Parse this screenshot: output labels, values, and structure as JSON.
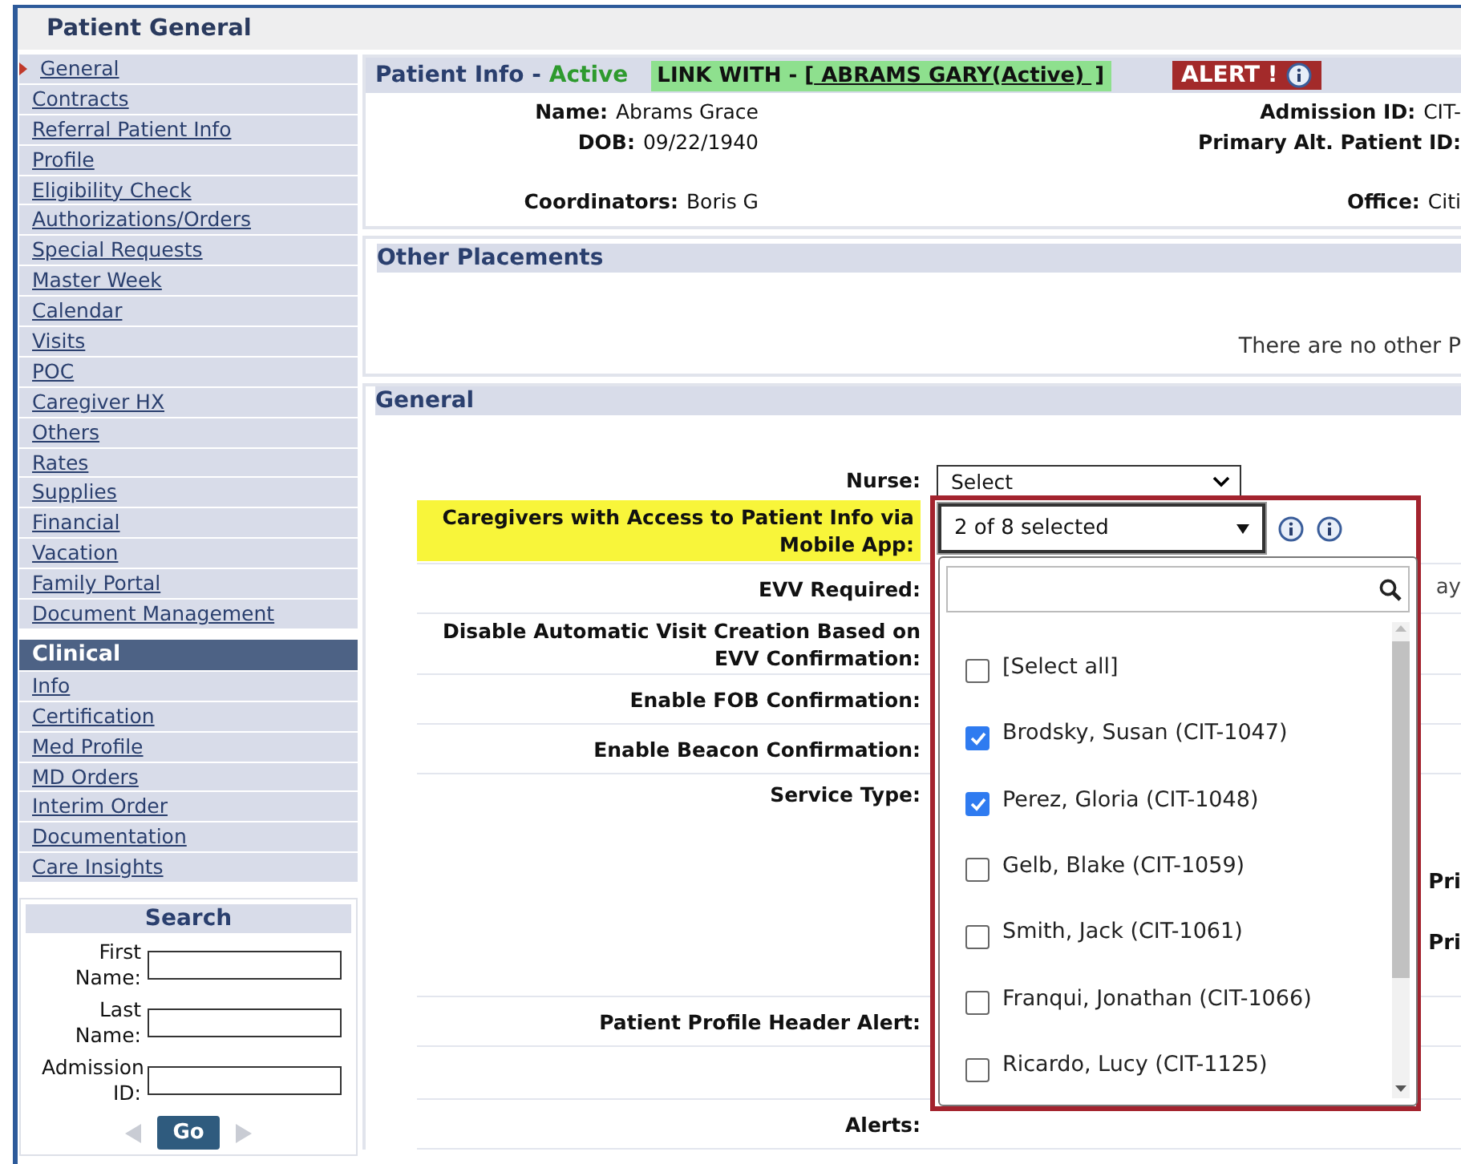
{
  "window": {
    "title": "Patient General"
  },
  "sidebar": {
    "items": [
      {
        "label": "General",
        "selected": true
      },
      {
        "label": "Contracts",
        "selected": false
      },
      {
        "label": "Referral Patient Info",
        "selected": false
      },
      {
        "label": "Profile",
        "selected": false
      },
      {
        "label": "Eligibility Check",
        "selected": false
      },
      {
        "label": "Authorizations/Orders",
        "selected": false
      },
      {
        "label": "Special Requests",
        "selected": false
      },
      {
        "label": "Master Week",
        "selected": false
      },
      {
        "label": "Calendar",
        "selected": false
      },
      {
        "label": "Visits",
        "selected": false
      },
      {
        "label": "POC",
        "selected": false
      },
      {
        "label": "Caregiver HX",
        "selected": false
      },
      {
        "label": "Others",
        "selected": false
      },
      {
        "label": "Rates",
        "selected": false
      },
      {
        "label": "Supplies",
        "selected": false
      },
      {
        "label": "Financial",
        "selected": false
      },
      {
        "label": "Vacation",
        "selected": false
      },
      {
        "label": "Family Portal",
        "selected": false
      },
      {
        "label": "Document Management",
        "selected": false
      }
    ],
    "clinical": {
      "title": "Clinical",
      "items": [
        {
          "label": "Info",
          "selected": false
        },
        {
          "label": "Certification",
          "selected": false
        },
        {
          "label": "Med Profile",
          "selected": false
        },
        {
          "label": "MD Orders",
          "selected": false
        },
        {
          "label": "Interim Order",
          "selected": false
        },
        {
          "label": "Documentation",
          "selected": false
        },
        {
          "label": "Care Insights",
          "selected": false
        }
      ]
    },
    "search": {
      "title": "Search",
      "fields": [
        {
          "label": "First Name:"
        },
        {
          "label": "Last Name:"
        },
        {
          "label": "Admission ID:"
        }
      ],
      "button": "Go"
    }
  },
  "patient_info": {
    "title": "Patient Info -",
    "status": "Active",
    "link": {
      "prefix": "LINK WITH - [",
      "name": " ABRAMS GARY(Active) ",
      "suffix": "]"
    },
    "alert": "ALERT !",
    "rows": [
      {
        "left_label": "Name:",
        "left_value": "Abrams Grace",
        "right_label": "Admission ID:",
        "right_value": "CIT-"
      },
      {
        "left_label": "DOB:",
        "left_value": "09/22/1940",
        "right_label": "Primary Alt. Patient ID:"
      },
      {
        "left_label": "Coordinators:",
        "left_value": "Boris G",
        "right_label": "Office:",
        "right_value": "Citi"
      }
    ]
  },
  "other_placements": {
    "title": "Other Placements",
    "message": "There are no other P"
  },
  "general": {
    "title": "General",
    "rows": [
      {
        "kind": "select",
        "label": "Nurse:",
        "highlighted": false,
        "value": "Select"
      },
      {
        "kind": "multiselect",
        "label": "Caregivers with Access to Patient Info via Mobile App:",
        "highlighted": true,
        "value": "2 of 8 selected",
        "options": [
          {
            "label": "[Select all]",
            "checked": false
          },
          {
            "label": "Brodsky, Susan (CIT-1047)",
            "checked": true
          },
          {
            "label": "Perez, Gloria (CIT-1048)",
            "checked": true
          },
          {
            "label": "Gelb, Blake (CIT-1059)",
            "checked": false
          },
          {
            "label": "Smith, Jack (CIT-1061)",
            "checked": false
          },
          {
            "label": "Franqui, Jonathan (CIT-1066)",
            "checked": false
          },
          {
            "label": "Ricardo, Lucy (CIT-1125)",
            "checked": false
          }
        ]
      },
      {
        "kind": "covered",
        "label": "EVV Required:",
        "highlighted": false,
        "fragments": [
          "ay"
        ]
      },
      {
        "kind": "covered",
        "label": "Disable Automatic Visit Creation Based on EVV Confirmation:",
        "highlighted": false
      },
      {
        "kind": "covered",
        "label": "Enable FOB Confirmation:",
        "highlighted": false
      },
      {
        "kind": "covered",
        "label": "Enable Beacon Confirmation:",
        "highlighted": false
      },
      {
        "kind": "tall",
        "label": "Service Type:",
        "highlighted": false,
        "fragments": [
          "Pri",
          "Pri"
        ]
      },
      {
        "kind": "covered",
        "label": "Patient Profile Header Alert:",
        "highlighted": false
      },
      {
        "kind": "blank"
      },
      {
        "kind": "covered",
        "label": "Alerts:",
        "highlighted": false
      }
    ]
  }
}
